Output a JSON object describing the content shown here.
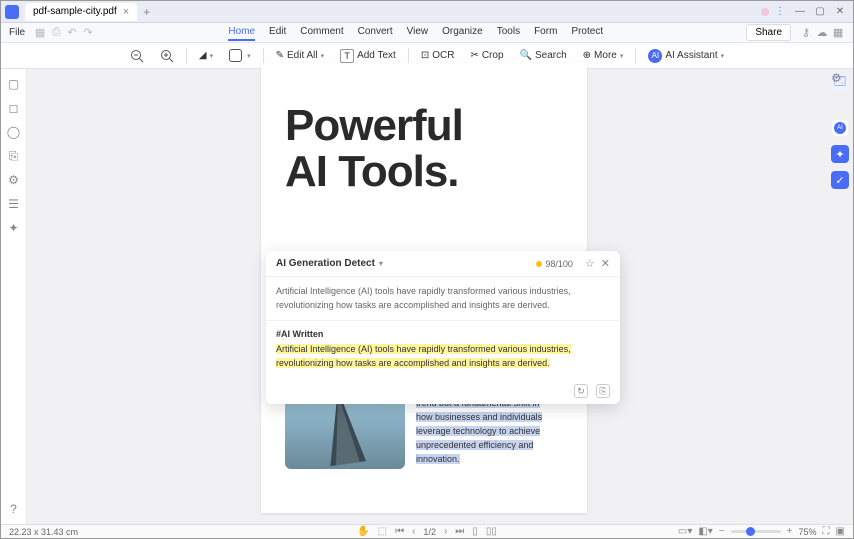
{
  "titlebar": {
    "filename": "pdf-sample-city.pdf",
    "min": "—",
    "max": "▢",
    "close": "✕"
  },
  "menubar": {
    "file": "File",
    "tabs": [
      "Home",
      "Edit",
      "Comment",
      "Convert",
      "View",
      "Organize",
      "Tools",
      "Form",
      "Protect"
    ],
    "active": "Home",
    "share": "Share"
  },
  "toolbar": {
    "edit_all": "Edit All",
    "add_text": "Add Text",
    "ocr": "OCR",
    "crop": "Crop",
    "search": "Search",
    "more": "More",
    "ai_assistant": "AI Assistant"
  },
  "document": {
    "title_line1": "Powerful",
    "title_line2": "AI Tools.",
    "paragraph": "These powerful tools are not just a trend but a fundamental shift in how businesses and individuals leverage technology to achieve unprecedented efficiency and innovation."
  },
  "popup": {
    "title": "AI Generation Detect",
    "score": "98/100",
    "summary": "Artificial Intelligence (AI) tools have rapidly transformed various industries, revolutionizing how tasks are accomplished and insights are derived.",
    "section_label": "#AI Written",
    "highlighted": "Artificial Intelligence (AI) tools have rapidly transformed various industries, revolutionizing how tasks are accomplished and insights are derived."
  },
  "statusbar": {
    "dims": "22.23 x 31.43 cm",
    "page": "1",
    "pages": "2",
    "zoom": "75%"
  }
}
